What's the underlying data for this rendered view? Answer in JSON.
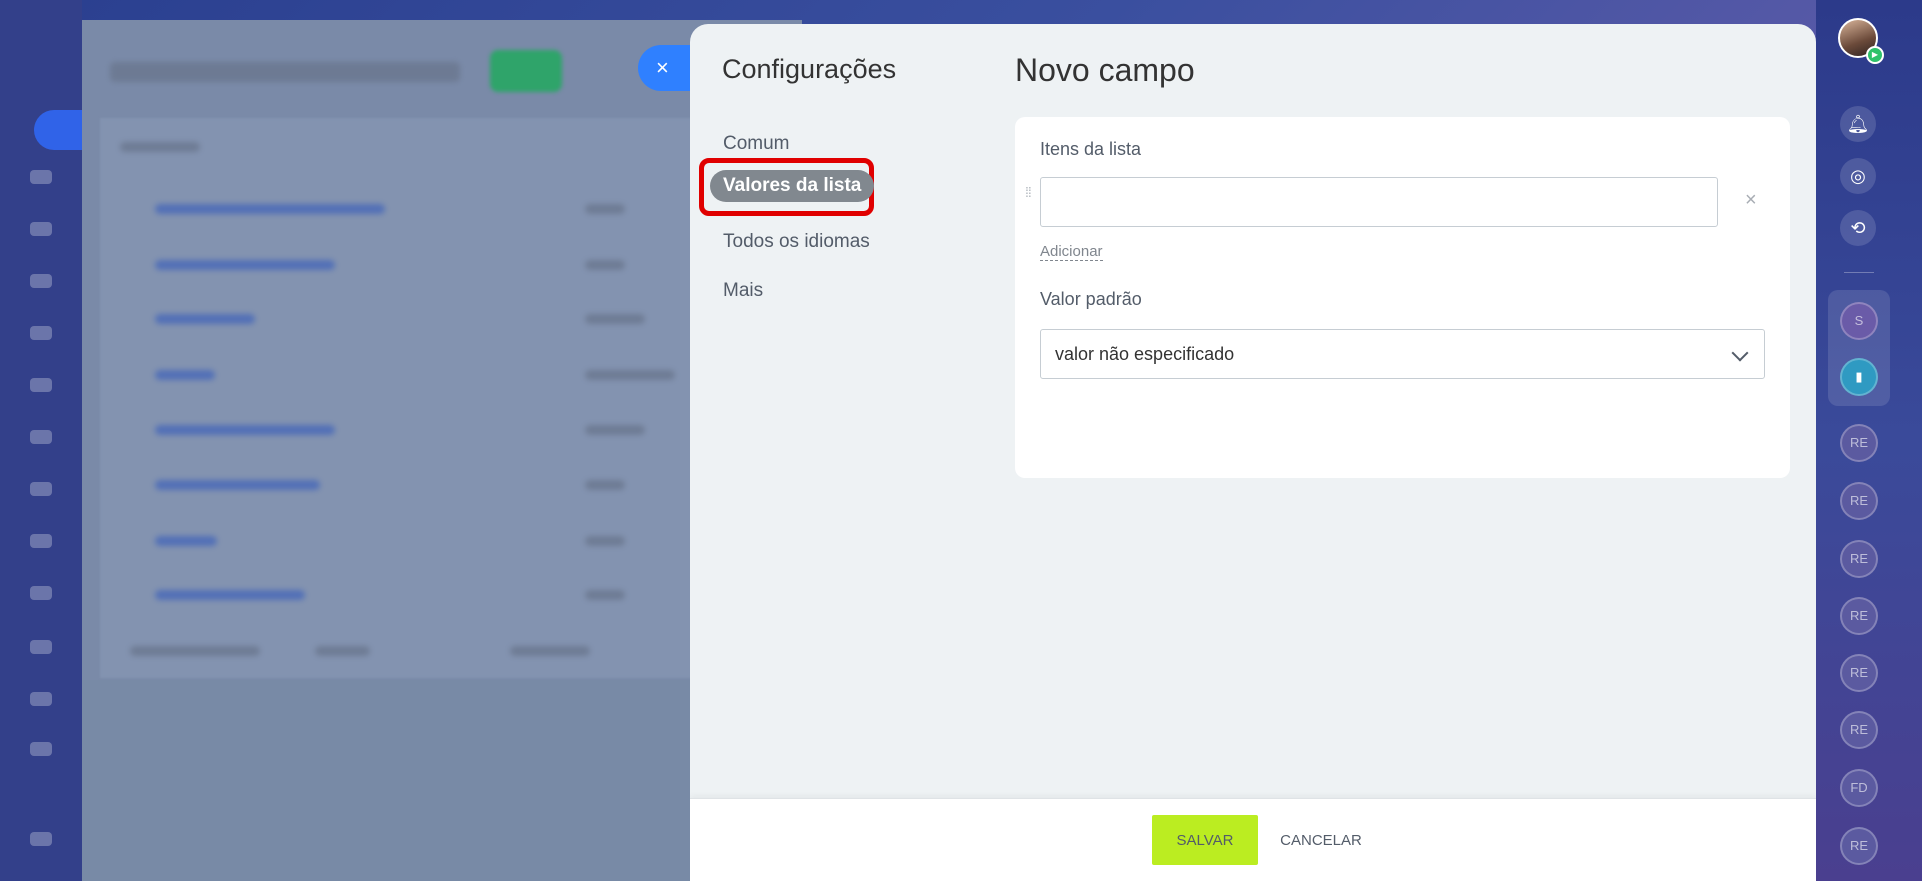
{
  "dialog": {
    "close_icon": "×",
    "sidebar_title": "Configurações",
    "nav": [
      {
        "label": "Comum",
        "active": false
      },
      {
        "label": "Valores da lista",
        "active": true
      },
      {
        "label": "Todos os idiomas",
        "active": false
      },
      {
        "label": "Mais",
        "active": false
      }
    ],
    "title": "Novo campo",
    "list_items_label": "Itens da lista",
    "list_item_value": "",
    "remove_icon": "×",
    "add_link": "Adicionar",
    "default_value_label": "Valor padrão",
    "default_value_selected": "valor não especificado",
    "save_label": "SALVAR",
    "cancel_label": "CANCELAR"
  },
  "right_bar": {
    "chat_avatars": [
      "S",
      "RE",
      "RE",
      "RE",
      "RE",
      "RE",
      "RE",
      "FD",
      "RE"
    ]
  },
  "colors": {
    "accent_blue": "#2f80ff",
    "save_green": "#bbed21",
    "highlight_red": "#e00000",
    "active_pill": "#81888f"
  }
}
